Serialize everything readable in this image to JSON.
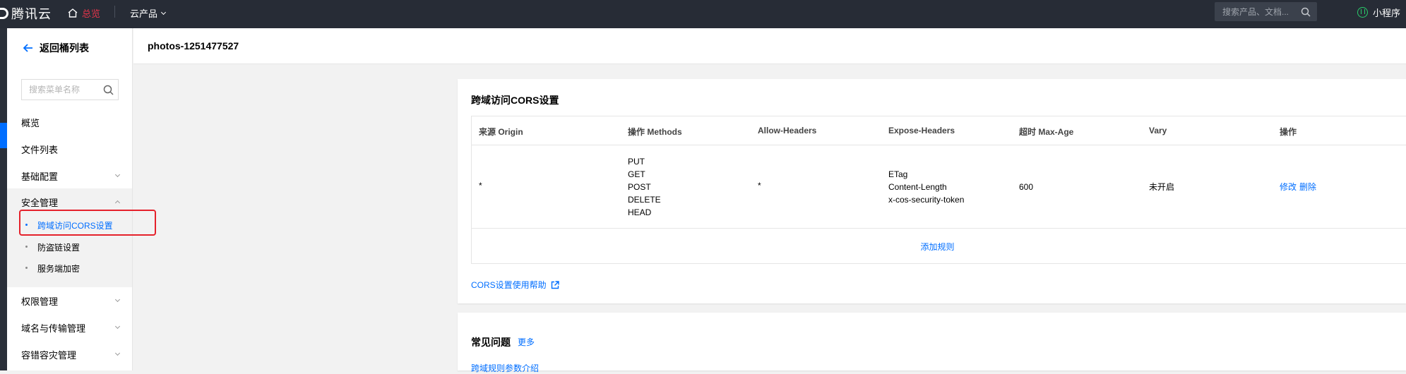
{
  "topbar": {
    "logo_text": "腾讯云",
    "home_label": "总览",
    "products_label": "云产品",
    "search_placeholder": "搜索产品、文档...",
    "mini_program_label": "小程序"
  },
  "sidebar": {
    "back_label": "返回桶列表",
    "search_placeholder": "搜索菜单名称",
    "items": [
      {
        "label": "概览"
      },
      {
        "label": "文件列表"
      },
      {
        "label": "基础配置"
      },
      {
        "label": "安全管理"
      },
      {
        "label": "权限管理"
      },
      {
        "label": "域名与传输管理"
      },
      {
        "label": "容错容灾管理"
      }
    ],
    "security_sub": [
      {
        "label": "跨域访问CORS设置",
        "active": true
      },
      {
        "label": "防盗链设置"
      },
      {
        "label": "服务端加密"
      }
    ]
  },
  "header": {
    "bucket_name": "photos-1251477527"
  },
  "cors": {
    "title": "跨域访问CORS设置",
    "columns": [
      "来源 Origin",
      "操作 Methods",
      "Allow-Headers",
      "Expose-Headers",
      "超时 Max-Age",
      "Vary",
      "操作"
    ],
    "row": {
      "origin": "*",
      "methods": [
        "PUT",
        "GET",
        "POST",
        "DELETE",
        "HEAD"
      ],
      "allow_headers": "*",
      "expose_headers": [
        "ETag",
        "Content-Length",
        "x-cos-security-token"
      ],
      "max_age": "600",
      "vary": "未开启",
      "action_edit": "修改",
      "action_delete": "删除"
    },
    "add_rule_label": "添加规则",
    "help_label": "CORS设置使用帮助"
  },
  "faq": {
    "title": "常见问题",
    "more_label": "更多",
    "first_link": "跨域规则参数介绍"
  },
  "colors": {
    "topbar_bg": "#272c36",
    "accent_blue": "#006eff",
    "highlight_red": "#e5212b",
    "home_red": "#e5344a"
  }
}
